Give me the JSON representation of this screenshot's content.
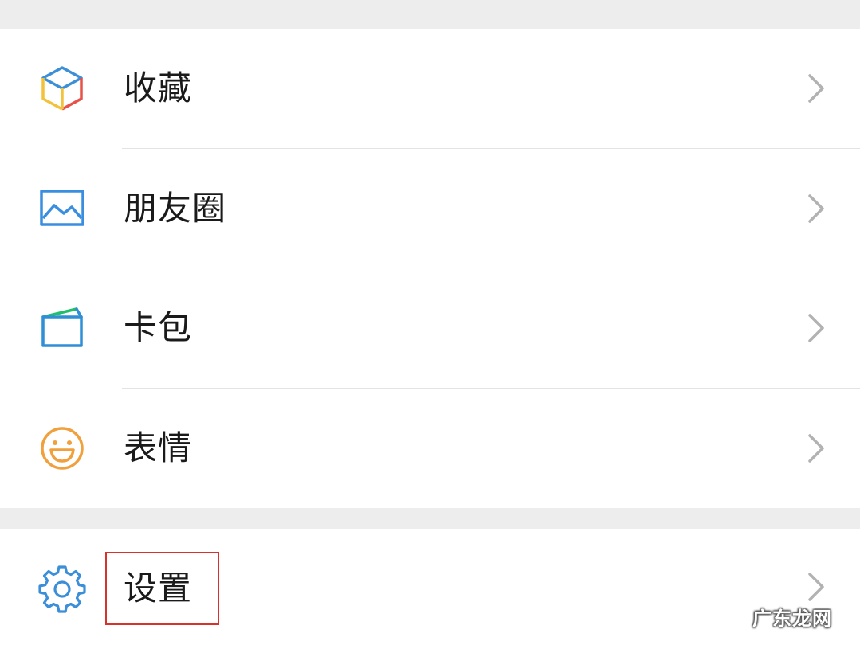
{
  "menu": {
    "group1": [
      {
        "label": "收藏",
        "icon": "favorites-cube-icon"
      },
      {
        "label": "朋友圈",
        "icon": "moments-picture-icon"
      },
      {
        "label": "卡包",
        "icon": "card-wallet-icon"
      },
      {
        "label": "表情",
        "icon": "sticker-smiley-icon"
      }
    ],
    "group2": [
      {
        "label": "设置",
        "icon": "gear-icon"
      }
    ]
  },
  "watermark": "广东龙网",
  "colors": {
    "background": "#ededed",
    "row_background": "#ffffff",
    "text": "#1a1a1a",
    "chevron": "#b2b2b2",
    "divider": "#e3e3e3",
    "highlight": "#d8322c",
    "favorites_blue": "#3c8fd6",
    "favorites_yellow": "#f3c23b",
    "favorites_red": "#e6524a",
    "moments_blue": "#3a8ee0",
    "wallet_blue": "#2f8fd6",
    "wallet_green": "#20c06a",
    "smiley_orange": "#f0a03c",
    "gear_blue": "#3b8ed8"
  }
}
